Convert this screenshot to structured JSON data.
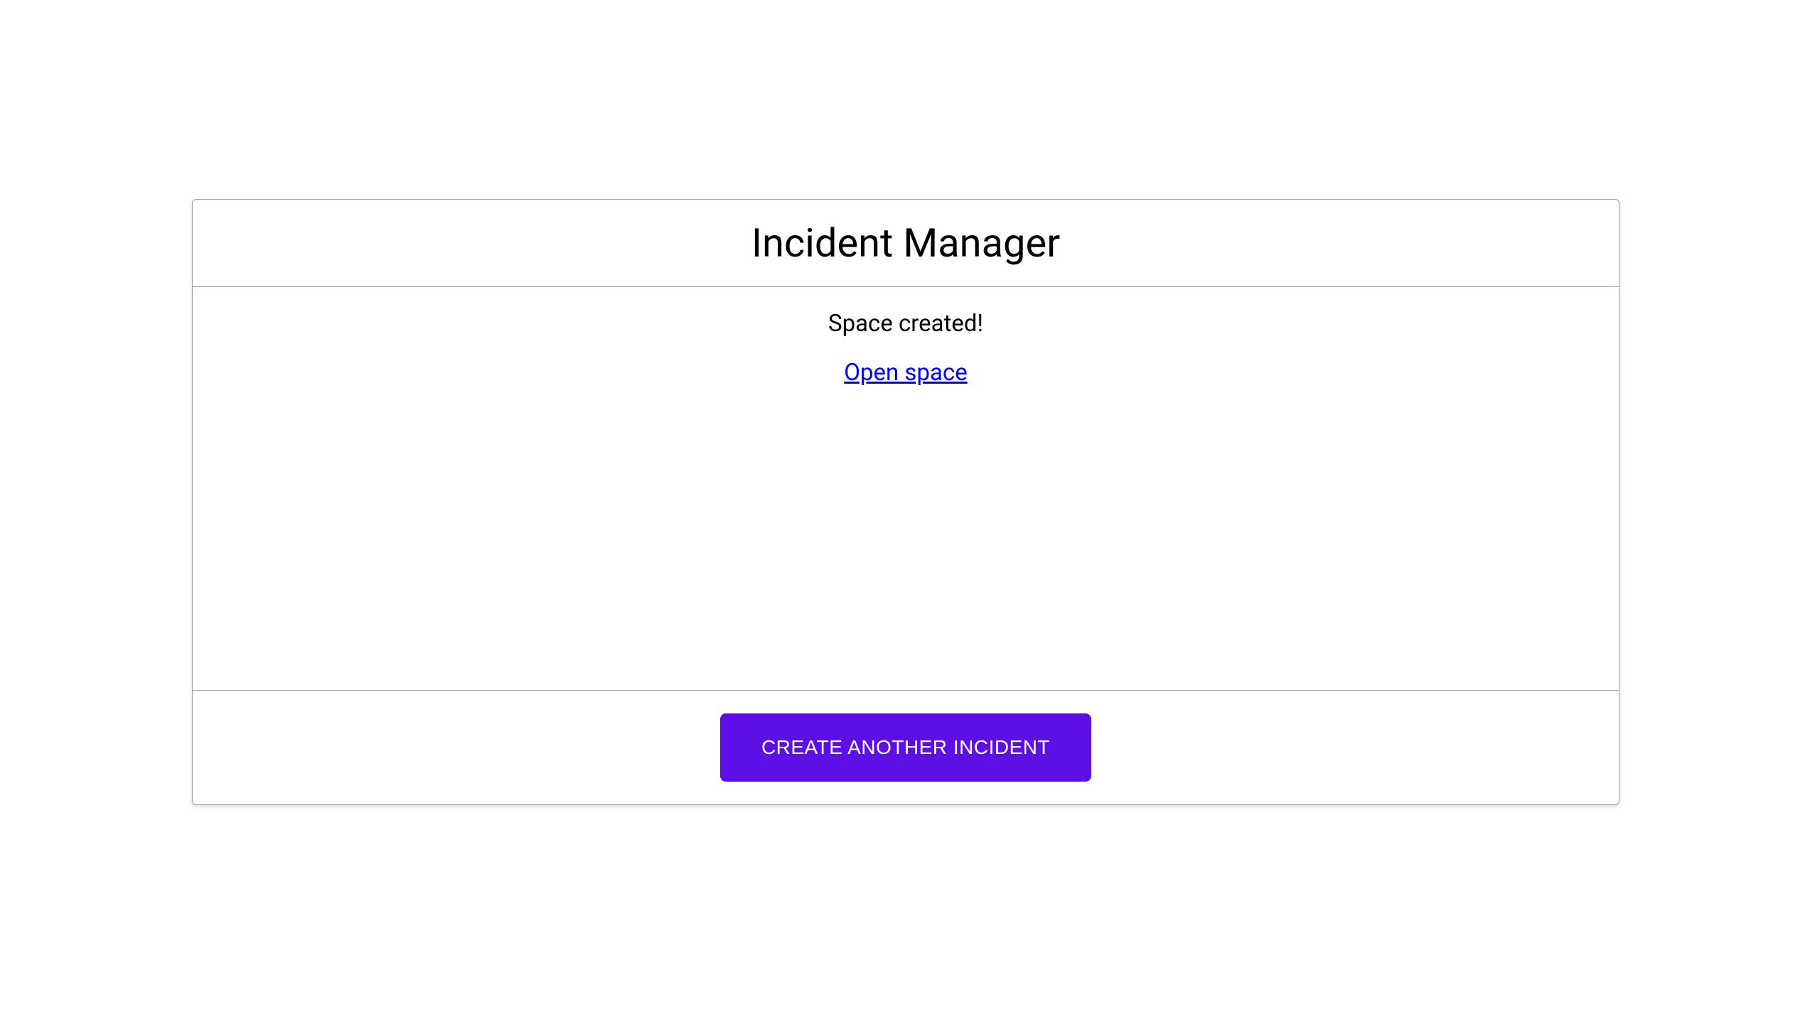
{
  "card": {
    "title": "Incident Manager",
    "status_message": "Space created!",
    "open_link_label": "Open space",
    "create_button_label": "CREATE ANOTHER INCIDENT"
  },
  "colors": {
    "accent": "#5e0fe6",
    "link": "#0000ee",
    "border": "#9e9e9e"
  }
}
